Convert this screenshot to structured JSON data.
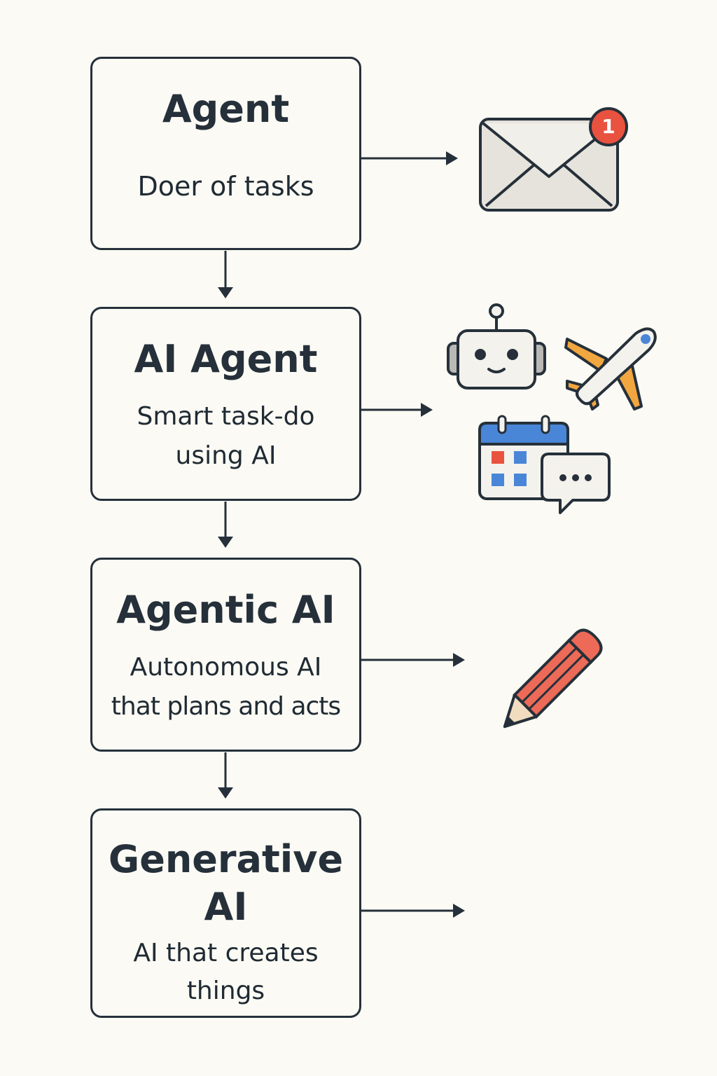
{
  "nodes": [
    {
      "title": "Agent",
      "subtitle_lines": [
        "Doer of tasks"
      ],
      "icons": [
        "envelope-icon"
      ]
    },
    {
      "title": "AI Agent",
      "subtitle_lines": [
        "Smart task-do",
        "using AI"
      ],
      "icons": [
        "robot-icon",
        "airplane-icon",
        "calendar-icon",
        "chat-bubble-icon"
      ]
    },
    {
      "title": "Agentic AI",
      "subtitle_lines": [
        "Autonomous AI",
        "that plans and acts"
      ],
      "icons": [
        "pencil-icon"
      ]
    },
    {
      "title_lines": [
        "Generative",
        "AI"
      ],
      "subtitle_lines": [
        "AI that creates",
        "things"
      ],
      "icons": []
    }
  ],
  "notification_badge": "1",
  "colors": {
    "background": "#fbfaf4",
    "stroke": "#25303a",
    "badge": "#e8523f",
    "calendar_blue": "#4a86d8",
    "calendar_red": "#e8523f",
    "airplane_orange": "#f2a640",
    "pencil_red": "#ec6a57"
  }
}
